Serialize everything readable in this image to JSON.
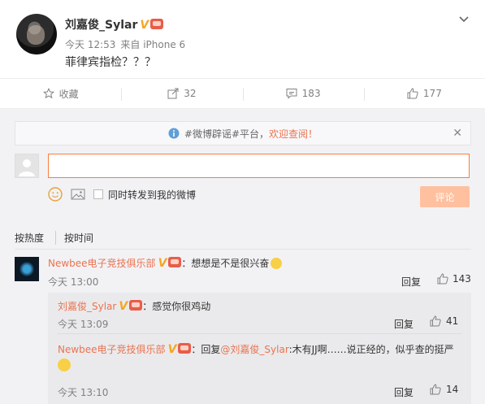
{
  "post": {
    "author": "刘嘉俊_Sylar",
    "vbadge": "V",
    "time": "今天 12:53",
    "via": "来自 iPhone 6",
    "content": "菲律宾指检？？？"
  },
  "actions": {
    "favorite": "收藏",
    "repost_count": "32",
    "comment_count": "183",
    "like_count": "177"
  },
  "notice": {
    "prefix": "#微博辟谣#平台，",
    "link": "欢迎查阅！",
    "close": "✕"
  },
  "composer": {
    "input_value": "",
    "sync_label": "同时转发到我的微博",
    "submit_label": "评论"
  },
  "sort": {
    "hot": "按热度",
    "time": "按时间"
  },
  "comments": [
    {
      "author": "Newbee电子竞技俱乐部",
      "vbadge": "V",
      "text": "：想想是不是很兴奋",
      "time": "今天 13:00",
      "reply_label": "回复",
      "likes": "143"
    }
  ],
  "replies": [
    {
      "author": "刘嘉俊_Sylar",
      "vbadge": "V",
      "text": "：感觉你很鸡动",
      "time": "今天 13:09",
      "reply_label": "回复",
      "likes": "41"
    },
    {
      "author": "Newbee电子竞技俱乐部",
      "vbadge": "V",
      "prefix": "：回复",
      "mention": "@刘嘉俊_Sylar",
      "text": ":木有JJ啊……说正经的，似乎查的挺严",
      "time": "今天 13:10",
      "reply_label": "回复",
      "likes": "14"
    }
  ],
  "colors": {
    "accent": "#eb7350",
    "vbadge": "#f5a623",
    "submit_disabled": "#ffc09f"
  }
}
